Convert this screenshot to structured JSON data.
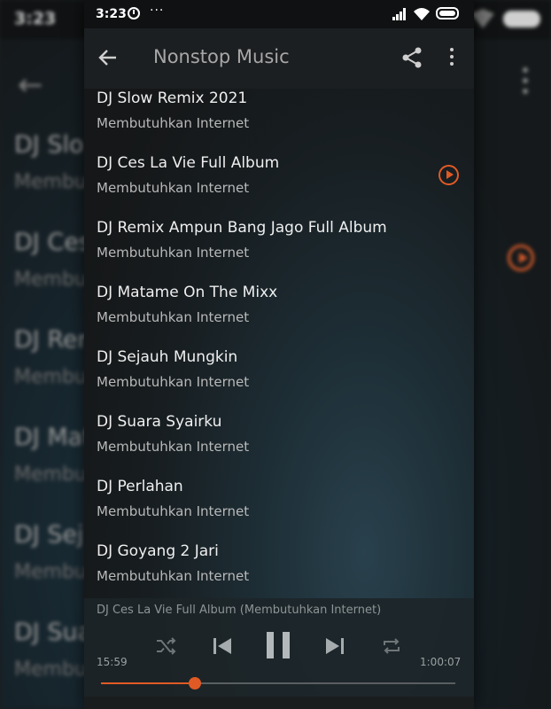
{
  "status_bar": {
    "time": "3:23",
    "more": "···"
  },
  "app_bar": {
    "title": "Nonstop Music"
  },
  "songs": [
    {
      "title": "DJ Slow Remix 2021",
      "subtitle": "Membutuhkan Internet",
      "playing": false
    },
    {
      "title": "DJ Ces La Vie Full Album",
      "subtitle": "Membutuhkan Internet",
      "playing": true
    },
    {
      "title": "DJ Remix Ampun Bang Jago Full Album",
      "subtitle": "Membutuhkan Internet",
      "playing": false
    },
    {
      "title": "DJ Matame On The Mixx",
      "subtitle": "Membutuhkan Internet",
      "playing": false
    },
    {
      "title": "DJ Sejauh Mungkin",
      "subtitle": "Membutuhkan Internet",
      "playing": false
    },
    {
      "title": "DJ Suara Syairku",
      "subtitle": "Membutuhkan Internet",
      "playing": false
    },
    {
      "title": "DJ Perlahan",
      "subtitle": "Membutuhkan Internet",
      "playing": false
    },
    {
      "title": "DJ Goyang 2 Jari",
      "subtitle": "Membutuhkan Internet",
      "playing": false
    }
  ],
  "player": {
    "now_playing": "DJ Ces La Vie Full Album (Membutuhkan Internet)",
    "elapsed": "15:59",
    "total": "1:00:07",
    "progress_fraction": 0.266
  },
  "background_mirror": {
    "time": "3:23",
    "titles": [
      "DJ Slo",
      "DJ Ces",
      "DJ Ren",
      "DJ Mat",
      "DJ Sej",
      "DJ Sua"
    ],
    "subs": [
      "Membu",
      "Membu",
      "Membu",
      "Membu",
      "Membu",
      "Membu"
    ]
  },
  "colors": {
    "accent": "#e05a25",
    "text": "#efefef",
    "subtext": "#b9b9b9",
    "appbar": "#1c1f21"
  },
  "icons": {
    "status": [
      "timer-icon",
      "signal-icon",
      "wifi-icon",
      "battery-icon"
    ],
    "app_bar": [
      "back-arrow-icon",
      "share-icon",
      "more-vert-icon"
    ],
    "player": [
      "shuffle-icon",
      "skip-previous-icon",
      "pause-icon",
      "skip-next-icon",
      "repeat-icon"
    ]
  }
}
